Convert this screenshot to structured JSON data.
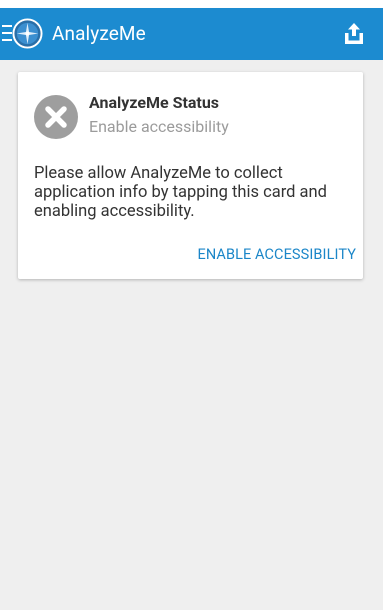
{
  "app_bar": {
    "title": "AnalyzeMe",
    "menu_icon": "hamburger-menu-icon",
    "logo_icon": "analyzeme-logo-icon",
    "share_icon": "share-upload-icon",
    "background_color": "#1c8bd0"
  },
  "status_card": {
    "icon": "error-x-circle-icon",
    "title": "AnalyzeMe Status",
    "subtitle": "Enable accessibility",
    "body": "Please allow AnalyzeMe to collect application info by tapping this card and enabling accessibility.",
    "action_label": "ENABLE ACCESSIBILITY",
    "action_color": "#1b86c8"
  },
  "content_background": "#efefef"
}
